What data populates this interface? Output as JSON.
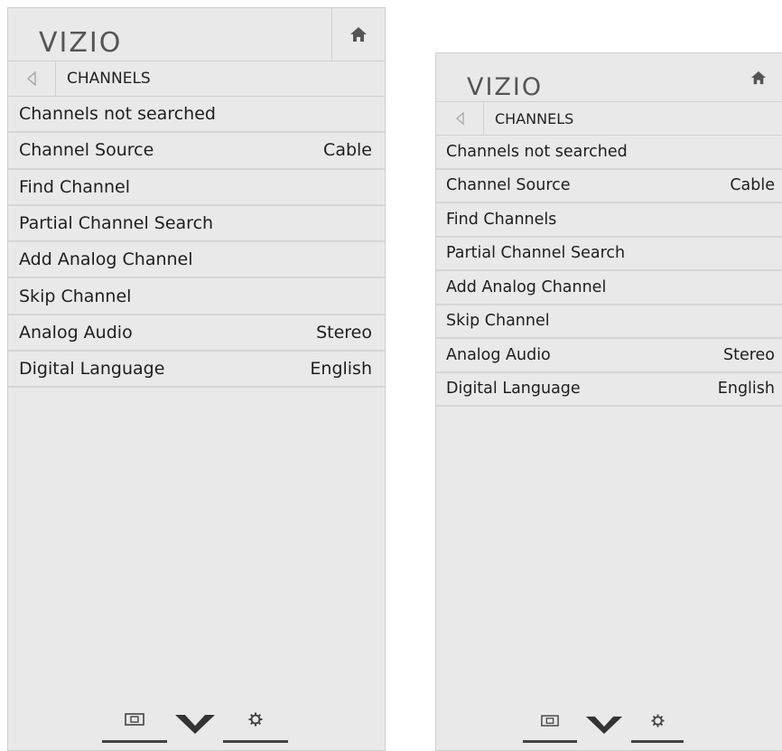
{
  "panels": [
    {
      "logo": "VIZIO",
      "breadcrumb": "CHANNELS",
      "items": [
        {
          "label": "Channels not searched",
          "value": ""
        },
        {
          "label": "Channel Source",
          "value": "Cable"
        },
        {
          "label": "Find Channel",
          "value": ""
        },
        {
          "label": "Partial Channel Search",
          "value": ""
        },
        {
          "label": "Add Analog Channel",
          "value": ""
        },
        {
          "label": "Skip Channel",
          "value": ""
        },
        {
          "label": "Analog Audio",
          "value": "Stereo"
        },
        {
          "label": "Digital Language",
          "value": "English"
        }
      ],
      "bottom_icons": [
        "input-icon",
        "vizio-v-icon",
        "settings-gear-icon"
      ]
    },
    {
      "logo": "VIZIO",
      "breadcrumb": "CHANNELS",
      "items": [
        {
          "label": "Channels not searched",
          "value": ""
        },
        {
          "label": "Channel Source",
          "value": "Cable"
        },
        {
          "label": "Find Channels",
          "value": ""
        },
        {
          "label": "Partial Channel Search",
          "value": ""
        },
        {
          "label": "Add Analog Channel",
          "value": ""
        },
        {
          "label": "Skip Channel",
          "value": ""
        },
        {
          "label": "Analog Audio",
          "value": "Stereo"
        },
        {
          "label": "Digital Language",
          "value": "English"
        }
      ],
      "bottom_icons": [
        "input-icon",
        "vizio-v-icon",
        "settings-gear-icon"
      ]
    }
  ],
  "header_icons": [
    "home-icon",
    "back-arrow-icon"
  ],
  "colors": {
    "panel_bg": "#e9e9e9",
    "divider": "#cfcfcf",
    "text": "#1e1e1e",
    "logo": "#555555"
  }
}
